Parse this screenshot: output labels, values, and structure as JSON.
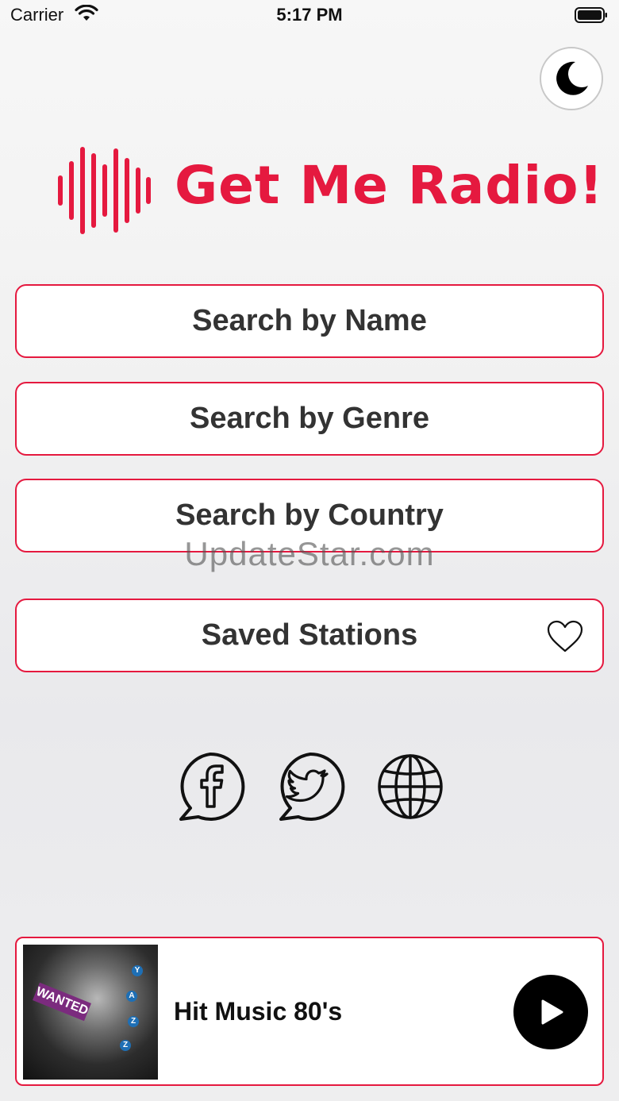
{
  "status_bar": {
    "carrier": "Carrier",
    "time": "5:17 PM"
  },
  "app": {
    "title": "Get Me Radio!"
  },
  "menu": {
    "search_by_name": "Search by Name",
    "search_by_genre": "Search by Genre",
    "search_by_country": "Search by Country",
    "saved_stations": "Saved Stations"
  },
  "watermark": "UpdateStar.com",
  "now_playing": {
    "station": "Hit Music 80's",
    "cover_tag": "WANTED",
    "cover_letters": [
      "Y",
      "A",
      "Z",
      "Z"
    ]
  },
  "colors": {
    "accent": "#e5193f",
    "button_text": "#333333"
  },
  "icons": {
    "theme_toggle": "moon-icon",
    "logo": "soundwave-icon",
    "saved": "heart-icon",
    "social": [
      "facebook-icon",
      "twitter-icon",
      "globe-icon"
    ],
    "play": "play-icon"
  }
}
